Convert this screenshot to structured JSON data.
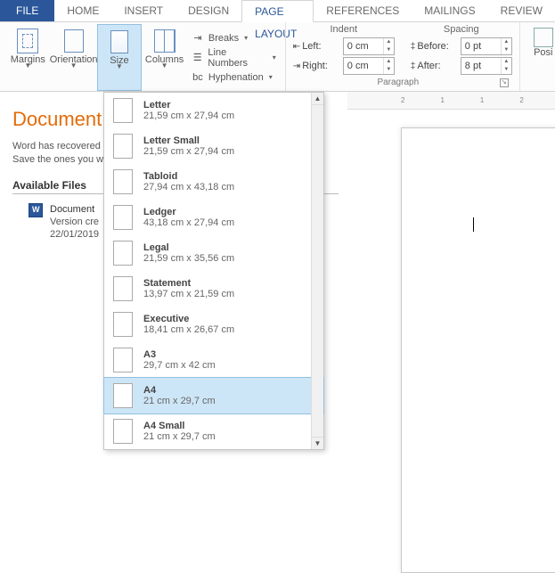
{
  "tabs": {
    "file": "FILE",
    "home": "HOME",
    "insert": "INSERT",
    "design": "DESIGN",
    "page_layout": "PAGE LAYOUT",
    "references": "REFERENCES",
    "mailings": "MAILINGS",
    "review": "REVIEW"
  },
  "ribbon": {
    "margins": "Margins",
    "orientation": "Orientation",
    "size": "Size",
    "columns": "Columns",
    "breaks": "Breaks",
    "line_numbers": "Line Numbers",
    "hyphenation": "Hyphenation",
    "indent_hdr": "Indent",
    "spacing_hdr": "Spacing",
    "left": "Left:",
    "right": "Right:",
    "before": "Before:",
    "after": "After:",
    "indent_left_val": "0 cm",
    "indent_right_val": "0 cm",
    "spacing_before_val": "0 pt",
    "spacing_after_val": "8 pt",
    "paragraph_footer": "Paragraph",
    "position": "Posi"
  },
  "recovery": {
    "title": "Document",
    "msg1": "Word has recovered",
    "msg2": "Save the ones you w",
    "available": "Available Files",
    "file_name": "Document",
    "file_line2": "Version cre",
    "file_line3": "22/01/2019"
  },
  "ruler": {
    "n1": "2",
    "n2": "1",
    "n3": "1",
    "n4": "2"
  },
  "sizes": [
    {
      "name": "Letter",
      "dim": "21,59 cm x 27,94 cm",
      "selected": false
    },
    {
      "name": "Letter Small",
      "dim": "21,59 cm x 27,94 cm",
      "selected": false
    },
    {
      "name": "Tabloid",
      "dim": "27,94 cm x 43,18 cm",
      "selected": false
    },
    {
      "name": "Ledger",
      "dim": "43,18 cm x 27,94 cm",
      "selected": false
    },
    {
      "name": "Legal",
      "dim": "21,59 cm x 35,56 cm",
      "selected": false
    },
    {
      "name": "Statement",
      "dim": "13,97 cm x 21,59 cm",
      "selected": false
    },
    {
      "name": "Executive",
      "dim": "18,41 cm x 26,67 cm",
      "selected": false
    },
    {
      "name": "A3",
      "dim": "29,7 cm x 42 cm",
      "selected": false
    },
    {
      "name": "A4",
      "dim": "21 cm x 29,7 cm",
      "selected": true
    },
    {
      "name": "A4 Small",
      "dim": "21 cm x 29,7 cm",
      "selected": false
    }
  ]
}
